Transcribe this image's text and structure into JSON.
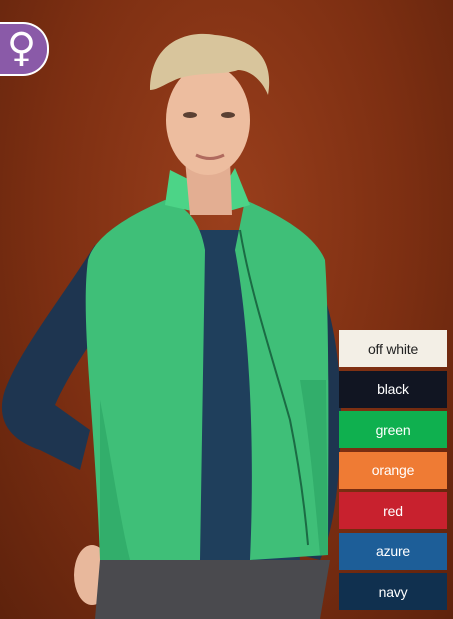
{
  "badge": {
    "icon": "female-symbol-icon",
    "glyph": "♀",
    "color": "#8a5aa8"
  },
  "colors": [
    {
      "label": "off white",
      "hex": "#f3efe6",
      "text": "#222222"
    },
    {
      "label": "black",
      "hex": "#111522",
      "text": "#ffffff"
    },
    {
      "label": "green",
      "hex": "#0fb04f",
      "text": "#ffffff"
    },
    {
      "label": "orange",
      "hex": "#ef7b34",
      "text": "#ffffff"
    },
    {
      "label": "red",
      "hex": "#c8212e",
      "text": "#ffffff"
    },
    {
      "label": "azure",
      "hex": "#1d5e98",
      "text": "#ffffff"
    },
    {
      "label": "navy",
      "hex": "#10304f",
      "text": "#ffffff"
    }
  ]
}
